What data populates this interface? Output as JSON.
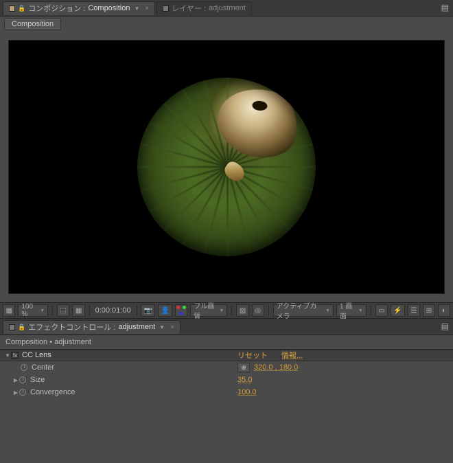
{
  "tabs": {
    "comp_prefix": "コンポジション :",
    "comp_name": "Composition",
    "layer_prefix": "レイヤー :",
    "layer_name": "adjustment"
  },
  "subtab": "Composition",
  "toolbar": {
    "zoom": "100 %",
    "time": "0:00:01:00",
    "quality": "フル画質",
    "camera": "アクティブカメラ",
    "view_count": "1 画面"
  },
  "fx_panel": {
    "tab_prefix": "エフェクトコントロール :",
    "tab_name": "adjustment",
    "crumb_comp": "Composition",
    "crumb_sep": " • ",
    "crumb_layer": "adjustment"
  },
  "effect": {
    "name": "CC Lens",
    "reset": "リセット",
    "about": "情報...",
    "props": {
      "center_label": "Center",
      "center_value": "320.0 , 180.0",
      "size_label": "Size",
      "size_value": "35.0",
      "conv_label": "Convergence",
      "conv_value": "100.0"
    }
  }
}
